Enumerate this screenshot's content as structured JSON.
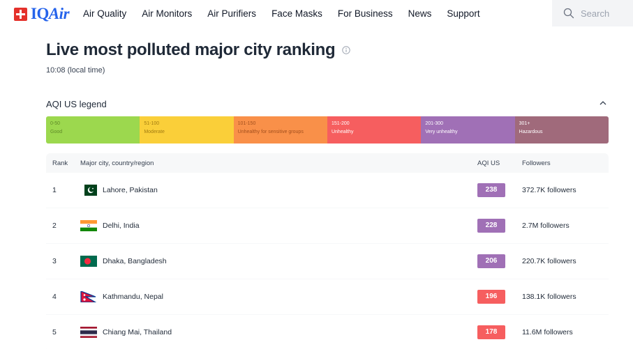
{
  "header": {
    "logo": {
      "prefix": "IQ",
      "suffix": "Air"
    },
    "nav": [
      "Air Quality",
      "Air Monitors",
      "Air Purifiers",
      "Face Masks",
      "For Business",
      "News",
      "Support"
    ],
    "search_placeholder": "Search"
  },
  "page": {
    "title": "Live most polluted major city ranking",
    "local_time": "10:08 (local time)"
  },
  "legend": {
    "title": "AQI US legend",
    "segments": [
      {
        "range": "0-50",
        "label": "Good",
        "color": "#9cd84e",
        "text_color": "#5f8a28"
      },
      {
        "range": "51-100",
        "label": "Moderate",
        "color": "#facf39",
        "text_color": "#a27c12"
      },
      {
        "range": "101-150",
        "label": "Unhealthy for sensitive groups",
        "color": "#f99049",
        "text_color": "#a24f1d"
      },
      {
        "range": "151-200",
        "label": "Unhealthy",
        "color": "#f65e5f",
        "text_color": "#ffffff"
      },
      {
        "range": "201-300",
        "label": "Very unhealthy",
        "color": "#a070b6",
        "text_color": "#ffffff"
      },
      {
        "range": "301+",
        "label": "Hazardous",
        "color": "#a06a7b",
        "text_color": "#ffffff"
      }
    ]
  },
  "table": {
    "headers": {
      "rank": "Rank",
      "city": "Major city, country/region",
      "aqi": "AQI US",
      "followers": "Followers"
    },
    "rows": [
      {
        "rank": "1",
        "city": "Lahore, Pakistan",
        "flag": "pakistan-flag",
        "aqi": "238",
        "aqi_color": "#a070b6",
        "followers": "372.7K followers"
      },
      {
        "rank": "2",
        "city": "Delhi, India",
        "flag": "india-flag",
        "aqi": "228",
        "aqi_color": "#a070b6",
        "followers": "2.7M followers"
      },
      {
        "rank": "3",
        "city": "Dhaka, Bangladesh",
        "flag": "bangladesh-flag",
        "aqi": "206",
        "aqi_color": "#a070b6",
        "followers": "220.7K followers"
      },
      {
        "rank": "4",
        "city": "Kathmandu, Nepal",
        "flag": "nepal-flag",
        "aqi": "196",
        "aqi_color": "#f65e5f",
        "followers": "138.1K followers"
      },
      {
        "rank": "5",
        "city": "Chiang Mai, Thailand",
        "flag": "thailand-flag",
        "aqi": "178",
        "aqi_color": "#f65e5f",
        "followers": "11.6M followers"
      }
    ]
  }
}
